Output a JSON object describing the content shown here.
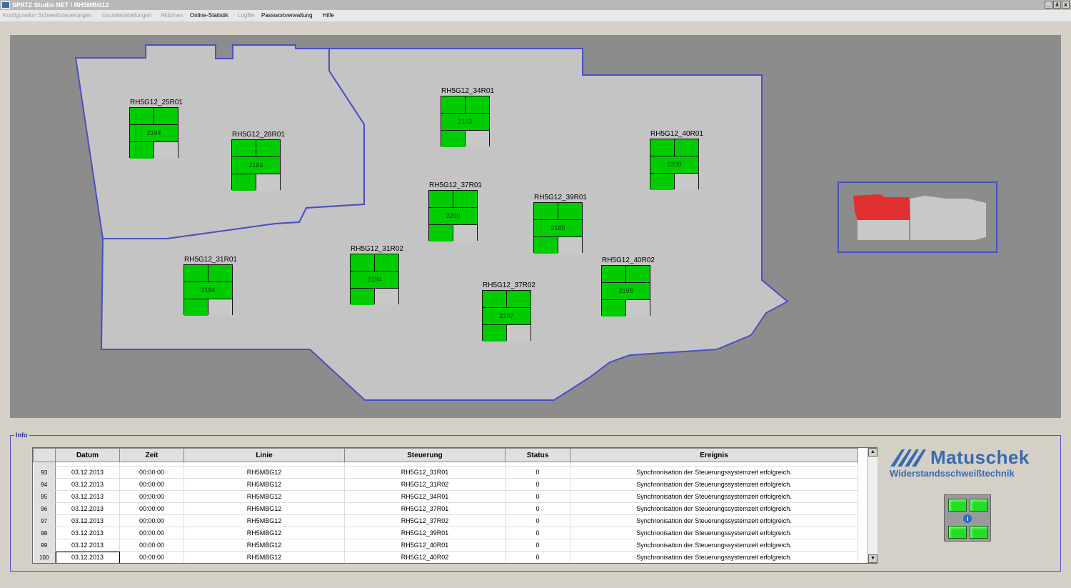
{
  "window": {
    "title": "SPATZ Studio NET / RH5MBG12",
    "buttons": [
      "_",
      "á",
      "x"
    ]
  },
  "menu": {
    "items": [
      {
        "label": "Konfiguration Schweißsteuerungen",
        "enabled": false
      },
      {
        "label": "Grundeinstellungen",
        "enabled": false
      },
      {
        "label": "Aktionen",
        "enabled": false
      },
      {
        "label": "Online-Statistik",
        "enabled": true
      },
      {
        "label": "Logfile",
        "enabled": false
      },
      {
        "label": "Passwortverwaltung",
        "enabled": true
      },
      {
        "label": "Hilfe",
        "enabled": true
      }
    ]
  },
  "stations": [
    {
      "name": "RH5G12_25R01",
      "value": "2194"
    },
    {
      "name": "RH5G12_28R01",
      "value": "2183"
    },
    {
      "name": "RH5G12_34R01",
      "value": "2193"
    },
    {
      "name": "RH5G12_40R01",
      "value": "2200"
    },
    {
      "name": "RH5G12_37R01",
      "value": "2200"
    },
    {
      "name": "RH5G12_39R01",
      "value": "2189"
    },
    {
      "name": "RH5G12_31R01",
      "value": "2194"
    },
    {
      "name": "RH5G12_31R02",
      "value": "2194"
    },
    {
      "name": "RH5G12_37R02",
      "value": "2187"
    },
    {
      "name": "RH5G12_40R02",
      "value": "2195"
    }
  ],
  "info": {
    "legend": "Info",
    "columns": [
      "Datum",
      "Zeit",
      "Linie",
      "Steuerung",
      "Status",
      "Ereignis"
    ],
    "rows": [
      {
        "nr": "93",
        "datum": "03.12.2013",
        "zeit": "00:00:00",
        "linie": "RH5MBG12",
        "steuerung": "RH5G12_31R01",
        "status": "0",
        "ereignis": "Synchronisation der Steuerungssystemzeit erfolgreich."
      },
      {
        "nr": "94",
        "datum": "03.12.2013",
        "zeit": "00:00:00",
        "linie": "RH5MBG12",
        "steuerung": "RH5G12_31R02",
        "status": "0",
        "ereignis": "Synchronisation der Steuerungssystemzeit erfolgreich."
      },
      {
        "nr": "95",
        "datum": "03.12.2013",
        "zeit": "00:00:00",
        "linie": "RH5MBG12",
        "steuerung": "RH5G12_34R01",
        "status": "0",
        "ereignis": "Synchronisation der Steuerungssystemzeit erfolgreich."
      },
      {
        "nr": "96",
        "datum": "03.12.2013",
        "zeit": "00:00:00",
        "linie": "RH5MBG12",
        "steuerung": "RH5G12_37R01",
        "status": "0",
        "ereignis": "Synchronisation der Steuerungssystemzeit erfolgreich."
      },
      {
        "nr": "97",
        "datum": "03.12.2013",
        "zeit": "00:00:00",
        "linie": "RH5MBG12",
        "steuerung": "RH5G12_37R02",
        "status": "0",
        "ereignis": "Synchronisation der Steuerungssystemzeit erfolgreich."
      },
      {
        "nr": "98",
        "datum": "03.12.2013",
        "zeit": "00:00:00",
        "linie": "RH5MBG12",
        "steuerung": "RH5G12_39R01",
        "status": "0",
        "ereignis": "Synchronisation der Steuerungssystemzeit erfolgreich."
      },
      {
        "nr": "99",
        "datum": "03.12.2013",
        "zeit": "00:00:00",
        "linie": "RH5MBG12",
        "steuerung": "RH5G12_40R01",
        "status": "0",
        "ereignis": "Synchronisation der Steuerungssystemzeit erfolgreich."
      },
      {
        "nr": "100",
        "datum": "03.12.2013",
        "zeit": "00:00:00",
        "linie": "RH5MBG12",
        "steuerung": "RH5G12_40R02",
        "status": "0",
        "ereignis": "Synchronisation der Steuerungssystemzeit erfolgreich."
      }
    ]
  },
  "logo": {
    "name": "Matuschek",
    "subtitle": "Widerstandsschweißtechnik"
  },
  "status_widget": {
    "icon": "info-icon",
    "glyph": "i"
  },
  "colors": {
    "station_ok": "#00cc00",
    "station_idle": "#c8c8c8",
    "outline": "#4a4fc4",
    "minimap_active": "#e03030",
    "brand": "#3a6ab0"
  }
}
